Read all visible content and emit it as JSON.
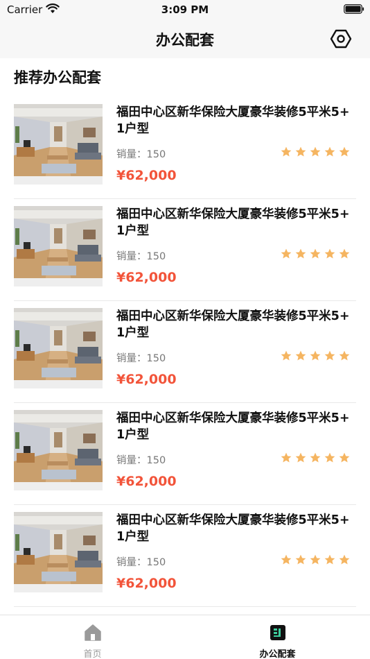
{
  "status_bar": {
    "carrier": "Carrier",
    "time": "3:09 PM"
  },
  "nav": {
    "title": "办公配套",
    "settings_icon": "settings-icon"
  },
  "section": {
    "title": "推荐办公配套"
  },
  "colors": {
    "price": "#f2543a",
    "star": "#f5b561",
    "tab_active": "#111111",
    "tab_inactive": "#9a9a9a"
  },
  "products": [
    {
      "title": "福田中心区新华保险大厦豪华装修5平米5+1户型",
      "sales": "销量：150",
      "rating": 5,
      "price": "¥62,000"
    },
    {
      "title": "福田中心区新华保险大厦豪华装修5平米5+1户型",
      "sales": "销量：150",
      "rating": 5,
      "price": "¥62,000"
    },
    {
      "title": "福田中心区新华保险大厦豪华装修5平米5+1户型",
      "sales": "销量：150",
      "rating": 5,
      "price": "¥62,000"
    },
    {
      "title": "福田中心区新华保险大厦豪华装修5平米5+1户型",
      "sales": "销量：150",
      "rating": 5,
      "price": "¥62,000"
    },
    {
      "title": "福田中心区新华保险大厦豪华装修5平米5+1户型",
      "sales": "销量：150",
      "rating": 5,
      "price": "¥62,000"
    }
  ],
  "tab_bar": {
    "home": {
      "label": "首页",
      "icon": "home-icon"
    },
    "office": {
      "label": "办公配套",
      "icon": "office-icon",
      "selected": true
    }
  }
}
